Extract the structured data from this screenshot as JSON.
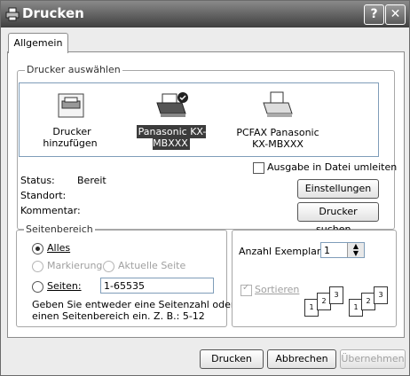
{
  "window": {
    "title": "Drucken",
    "help_label": "?",
    "close_label": "✕"
  },
  "tabs": [
    {
      "label": "Allgemein"
    }
  ],
  "printer_group": {
    "legend": "Drucker auswählen",
    "printers": [
      {
        "label": "Drucker hinzufügen",
        "icon": "add-printer-icon",
        "selected": false
      },
      {
        "label": "Panasonic KX-MBXXX",
        "icon": "printer-icon",
        "selected": true
      },
      {
        "label": "PCFAX Panasonic KX-MBXXX",
        "icon": "fax-printer-icon",
        "selected": false
      }
    ]
  },
  "status": {
    "status_label": "Status:",
    "status_value": "Bereit",
    "location_label": "Standort:",
    "comment_label": "Kommentar:",
    "print_to_file": "Ausgabe in Datei umleiten",
    "settings_button": "Einstellungen",
    "find_button": "Drucker suchen..."
  },
  "page_range": {
    "legend": "Seitenbereich",
    "all": "Alles",
    "selection": "Markierung",
    "current": "Aktuelle Seite",
    "pages": "Seiten:",
    "pages_value": "1-65535",
    "hint_line1": "Geben Sie entweder eine Seitenzahl oder",
    "hint_line2": "einen Seitenbereich ein. Z. B.: 5-12"
  },
  "copies": {
    "label": "Anzahl Exemplare:",
    "value": "1",
    "collate": "Sortieren",
    "page_numbers": [
      "1",
      "2",
      "3",
      "1",
      "2",
      "3"
    ]
  },
  "buttons": {
    "print": "Drucken",
    "cancel": "Abbrechen",
    "apply": "Übernehmen"
  }
}
